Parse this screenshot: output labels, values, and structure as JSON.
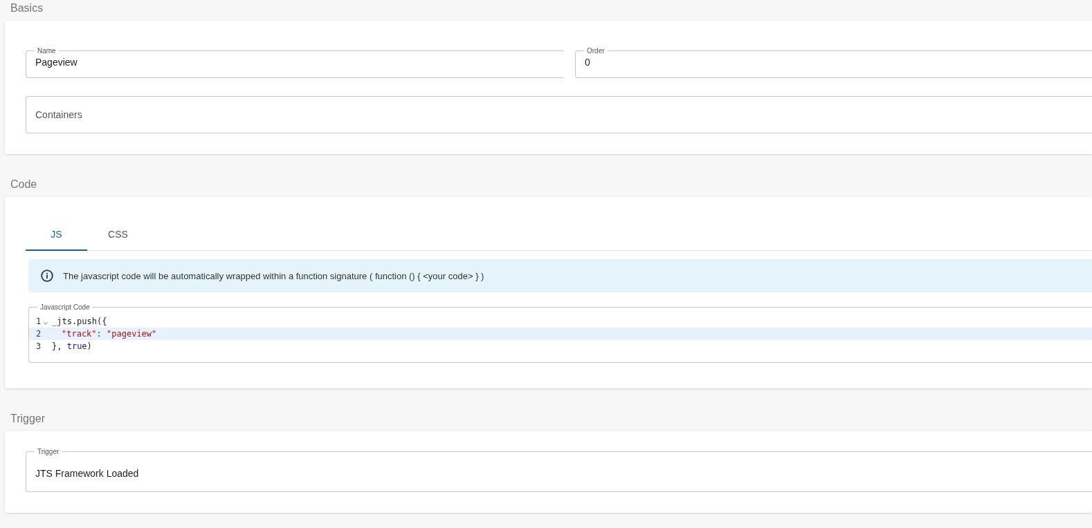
{
  "sections": [
    {
      "kind": "basics",
      "title": "Basics",
      "name_field": {
        "label": "Name",
        "value": "Pageview"
      },
      "order_field": {
        "label": "Order",
        "value": "0"
      },
      "containers_field": {
        "placeholder": "Containers"
      }
    },
    {
      "kind": "code",
      "title": "Code",
      "tabs": [
        {
          "label": "JS",
          "selected": true
        },
        {
          "label": "CSS",
          "selected": false
        }
      ],
      "info": "The javascript code will be automatically wrapped within a function signature ( function () { <your code> } )",
      "editor": {
        "label": "Javascript Code",
        "lines": [
          {
            "number": "1",
            "fold": true,
            "active": false,
            "indent": false,
            "tokens": [
              {
                "text": "_jts.push({",
                "kind": "plain"
              }
            ]
          },
          {
            "number": "2",
            "fold": false,
            "active": true,
            "indent": true,
            "tokens": [
              {
                "text": "\"track\"",
                "kind": "property"
              },
              {
                "text": ": ",
                "kind": "plain"
              },
              {
                "text": "\"pageview\"",
                "kind": "string"
              }
            ]
          },
          {
            "number": "3",
            "fold": false,
            "active": false,
            "indent": false,
            "tokens": [
              {
                "text": "}, ",
                "kind": "plain"
              },
              {
                "text": "true",
                "kind": "atom"
              },
              {
                "text": ")",
                "kind": "plain"
              }
            ]
          }
        ]
      }
    },
    {
      "kind": "trigger",
      "title": "Trigger",
      "trigger_field": {
        "label": "Trigger",
        "value": "JTS Framework Loaded"
      }
    }
  ]
}
